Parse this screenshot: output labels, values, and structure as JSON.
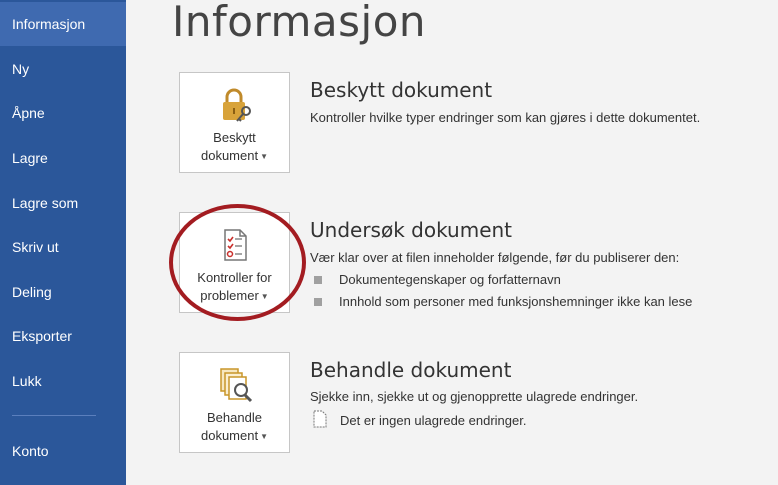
{
  "sidebar": {
    "items": [
      {
        "label": "Informasjon",
        "active": true
      },
      {
        "label": "Ny"
      },
      {
        "label": "Åpne"
      },
      {
        "label": "Lagre"
      },
      {
        "label": "Lagre som"
      },
      {
        "label": "Skriv ut"
      },
      {
        "label": "Deling"
      },
      {
        "label": "Eksporter"
      },
      {
        "label": "Lukk"
      }
    ],
    "account": "Konto"
  },
  "main": {
    "title": "Informasjon",
    "protect": {
      "button_line1": "Beskytt",
      "button_line2": "dokument",
      "title": "Beskytt dokument",
      "desc": "Kontroller hvilke typer endringer som kan gjøres i dette dokumentet."
    },
    "inspect": {
      "button_line1": "Kontroller for",
      "button_line2": "problemer",
      "title": "Undersøk dokument",
      "desc": "Vær klar over at filen inneholder følgende, før du publiserer den:",
      "bullets": [
        "Dokumentegenskaper og forfatternavn",
        "Innhold som personer med funksjonshemninger ikke kan lese"
      ]
    },
    "manage": {
      "button_line1": "Behandle",
      "button_line2": "dokument",
      "title": "Behandle dokument",
      "desc": "Sjekke inn, sjekke ut og gjenopprette ulagrede endringer.",
      "note": "Det er ingen ulagrede endringer."
    }
  },
  "colors": {
    "sidebar": "#2b579a",
    "sidebar_active": "#3f6ab0",
    "highlight": "#a31c21",
    "lock_gold": "#d8a33a"
  }
}
